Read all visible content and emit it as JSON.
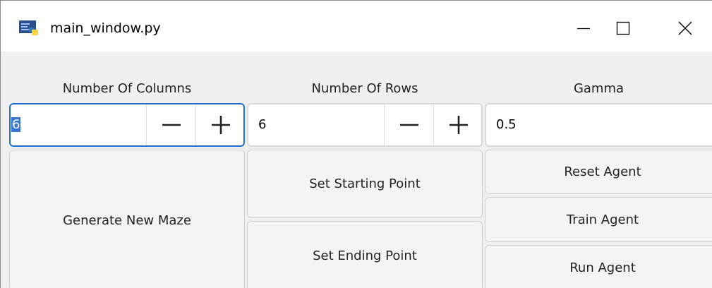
{
  "window": {
    "title": "main_window.py"
  },
  "controls": {
    "columns": {
      "label": "Number Of Columns",
      "value": "6"
    },
    "rows": {
      "label": "Number Of Rows",
      "value": "6"
    },
    "gamma": {
      "label": "Gamma",
      "value": "0.5"
    }
  },
  "buttons": {
    "generate_maze": "Generate New Maze",
    "set_start": "Set Starting Point",
    "set_end": "Set Ending Point",
    "reset_agent": "Reset Agent",
    "train_agent": "Train Agent",
    "run_agent": "Run Agent"
  },
  "icons": {
    "app": "python-file-icon",
    "minimize": "minimize-icon",
    "maximize": "maximize-icon",
    "close": "close-icon",
    "decrement": "minus-icon",
    "increment": "plus-icon"
  },
  "colors": {
    "focus_border": "#1f6fd1",
    "selection": "#3a74d6",
    "window_bg": "#f0f0f0"
  }
}
